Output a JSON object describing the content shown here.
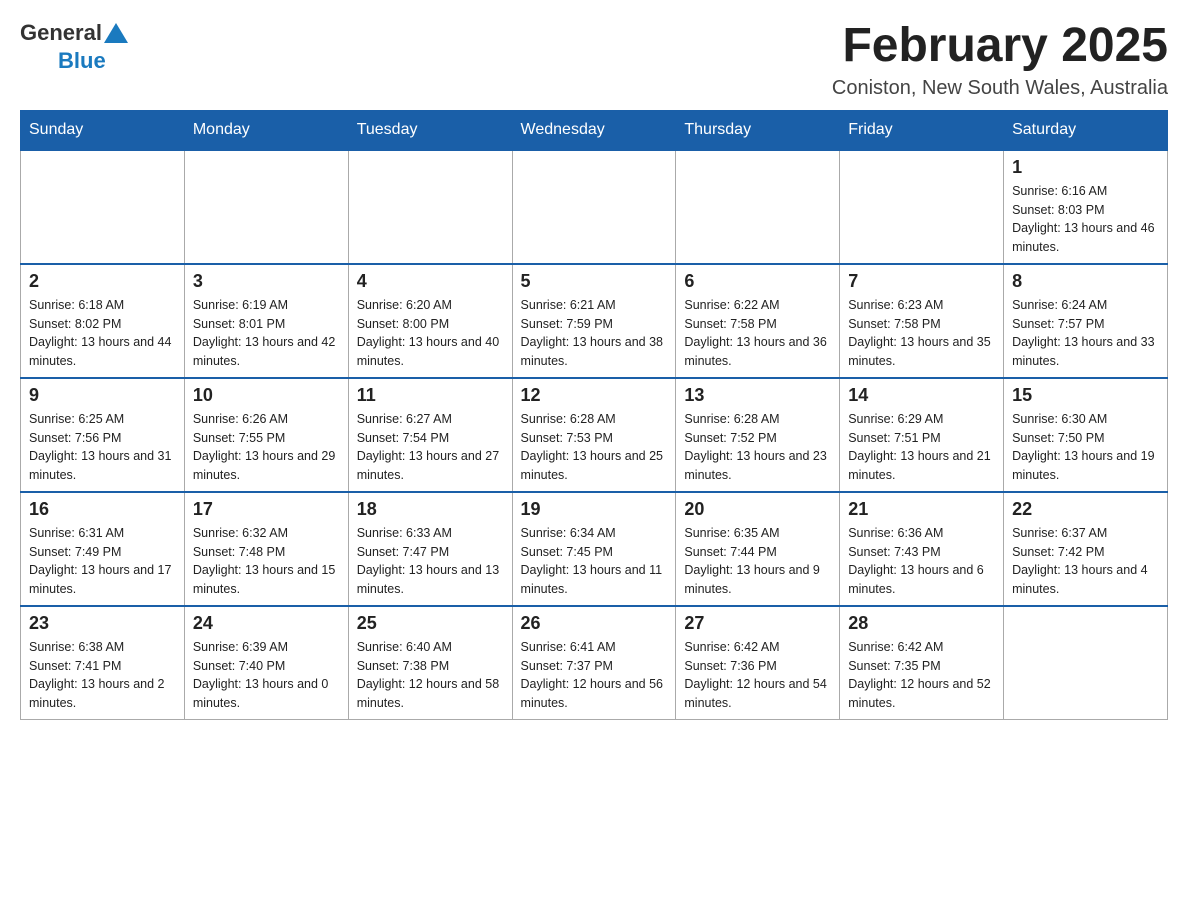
{
  "header": {
    "logo": {
      "general": "General",
      "blue": "Blue"
    },
    "title": "February 2025",
    "location": "Coniston, New South Wales, Australia"
  },
  "weekdays": [
    "Sunday",
    "Monday",
    "Tuesday",
    "Wednesday",
    "Thursday",
    "Friday",
    "Saturday"
  ],
  "weeks": [
    [
      {
        "day": "",
        "info": ""
      },
      {
        "day": "",
        "info": ""
      },
      {
        "day": "",
        "info": ""
      },
      {
        "day": "",
        "info": ""
      },
      {
        "day": "",
        "info": ""
      },
      {
        "day": "",
        "info": ""
      },
      {
        "day": "1",
        "info": "Sunrise: 6:16 AM\nSunset: 8:03 PM\nDaylight: 13 hours and 46 minutes."
      }
    ],
    [
      {
        "day": "2",
        "info": "Sunrise: 6:18 AM\nSunset: 8:02 PM\nDaylight: 13 hours and 44 minutes."
      },
      {
        "day": "3",
        "info": "Sunrise: 6:19 AM\nSunset: 8:01 PM\nDaylight: 13 hours and 42 minutes."
      },
      {
        "day": "4",
        "info": "Sunrise: 6:20 AM\nSunset: 8:00 PM\nDaylight: 13 hours and 40 minutes."
      },
      {
        "day": "5",
        "info": "Sunrise: 6:21 AM\nSunset: 7:59 PM\nDaylight: 13 hours and 38 minutes."
      },
      {
        "day": "6",
        "info": "Sunrise: 6:22 AM\nSunset: 7:58 PM\nDaylight: 13 hours and 36 minutes."
      },
      {
        "day": "7",
        "info": "Sunrise: 6:23 AM\nSunset: 7:58 PM\nDaylight: 13 hours and 35 minutes."
      },
      {
        "day": "8",
        "info": "Sunrise: 6:24 AM\nSunset: 7:57 PM\nDaylight: 13 hours and 33 minutes."
      }
    ],
    [
      {
        "day": "9",
        "info": "Sunrise: 6:25 AM\nSunset: 7:56 PM\nDaylight: 13 hours and 31 minutes."
      },
      {
        "day": "10",
        "info": "Sunrise: 6:26 AM\nSunset: 7:55 PM\nDaylight: 13 hours and 29 minutes."
      },
      {
        "day": "11",
        "info": "Sunrise: 6:27 AM\nSunset: 7:54 PM\nDaylight: 13 hours and 27 minutes."
      },
      {
        "day": "12",
        "info": "Sunrise: 6:28 AM\nSunset: 7:53 PM\nDaylight: 13 hours and 25 minutes."
      },
      {
        "day": "13",
        "info": "Sunrise: 6:28 AM\nSunset: 7:52 PM\nDaylight: 13 hours and 23 minutes."
      },
      {
        "day": "14",
        "info": "Sunrise: 6:29 AM\nSunset: 7:51 PM\nDaylight: 13 hours and 21 minutes."
      },
      {
        "day": "15",
        "info": "Sunrise: 6:30 AM\nSunset: 7:50 PM\nDaylight: 13 hours and 19 minutes."
      }
    ],
    [
      {
        "day": "16",
        "info": "Sunrise: 6:31 AM\nSunset: 7:49 PM\nDaylight: 13 hours and 17 minutes."
      },
      {
        "day": "17",
        "info": "Sunrise: 6:32 AM\nSunset: 7:48 PM\nDaylight: 13 hours and 15 minutes."
      },
      {
        "day": "18",
        "info": "Sunrise: 6:33 AM\nSunset: 7:47 PM\nDaylight: 13 hours and 13 minutes."
      },
      {
        "day": "19",
        "info": "Sunrise: 6:34 AM\nSunset: 7:45 PM\nDaylight: 13 hours and 11 minutes."
      },
      {
        "day": "20",
        "info": "Sunrise: 6:35 AM\nSunset: 7:44 PM\nDaylight: 13 hours and 9 minutes."
      },
      {
        "day": "21",
        "info": "Sunrise: 6:36 AM\nSunset: 7:43 PM\nDaylight: 13 hours and 6 minutes."
      },
      {
        "day": "22",
        "info": "Sunrise: 6:37 AM\nSunset: 7:42 PM\nDaylight: 13 hours and 4 minutes."
      }
    ],
    [
      {
        "day": "23",
        "info": "Sunrise: 6:38 AM\nSunset: 7:41 PM\nDaylight: 13 hours and 2 minutes."
      },
      {
        "day": "24",
        "info": "Sunrise: 6:39 AM\nSunset: 7:40 PM\nDaylight: 13 hours and 0 minutes."
      },
      {
        "day": "25",
        "info": "Sunrise: 6:40 AM\nSunset: 7:38 PM\nDaylight: 12 hours and 58 minutes."
      },
      {
        "day": "26",
        "info": "Sunrise: 6:41 AM\nSunset: 7:37 PM\nDaylight: 12 hours and 56 minutes."
      },
      {
        "day": "27",
        "info": "Sunrise: 6:42 AM\nSunset: 7:36 PM\nDaylight: 12 hours and 54 minutes."
      },
      {
        "day": "28",
        "info": "Sunrise: 6:42 AM\nSunset: 7:35 PM\nDaylight: 12 hours and 52 minutes."
      },
      {
        "day": "",
        "info": ""
      }
    ]
  ]
}
